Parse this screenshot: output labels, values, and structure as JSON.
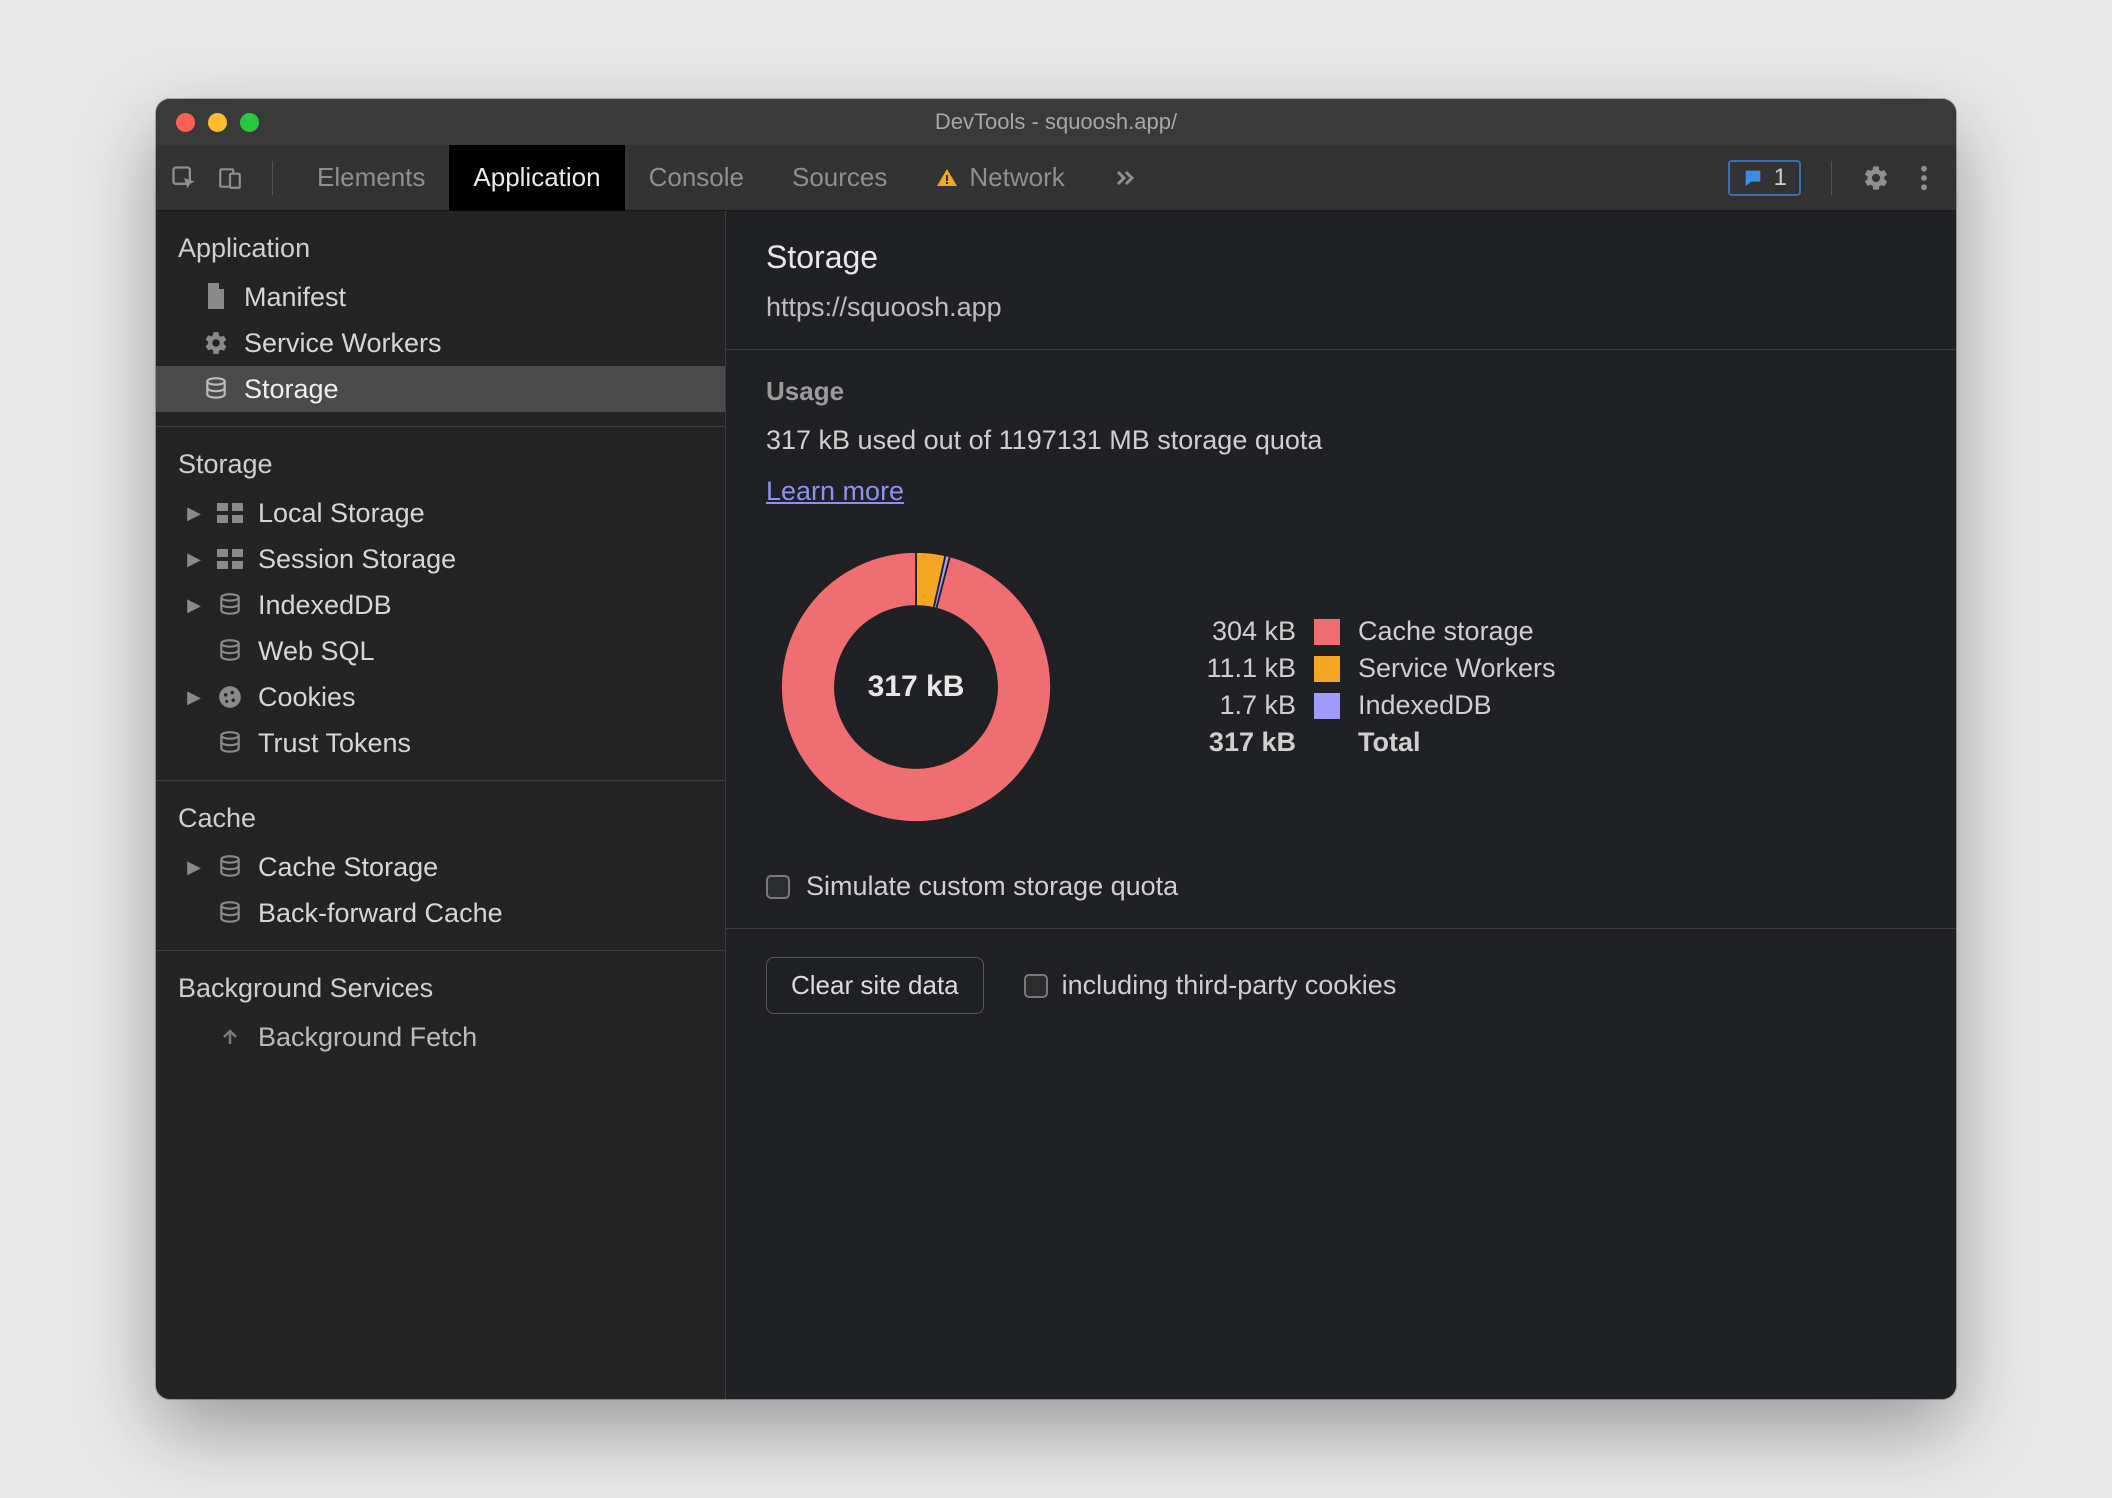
{
  "window": {
    "title": "DevTools - squoosh.app/"
  },
  "tabs": {
    "elements": "Elements",
    "application": "Application",
    "console": "Console",
    "sources": "Sources",
    "network": "Network"
  },
  "issues": {
    "count": "1"
  },
  "sidebar": {
    "sections": {
      "application": {
        "header": "Application",
        "items": [
          {
            "label": "Manifest"
          },
          {
            "label": "Service Workers"
          },
          {
            "label": "Storage"
          }
        ]
      },
      "storage": {
        "header": "Storage",
        "items": [
          {
            "label": "Local Storage"
          },
          {
            "label": "Session Storage"
          },
          {
            "label": "IndexedDB"
          },
          {
            "label": "Web SQL"
          },
          {
            "label": "Cookies"
          },
          {
            "label": "Trust Tokens"
          }
        ]
      },
      "cache": {
        "header": "Cache",
        "items": [
          {
            "label": "Cache Storage"
          },
          {
            "label": "Back-forward Cache"
          }
        ]
      },
      "bg": {
        "header": "Background Services",
        "items": [
          {
            "label": "Background Fetch"
          }
        ]
      }
    }
  },
  "panel": {
    "title": "Storage",
    "origin": "https://squoosh.app",
    "usage_header": "Usage",
    "usage_line": "317 kB used out of 1197131 MB storage quota",
    "learn_more": "Learn more",
    "donut_center": "317 kB",
    "legend": [
      {
        "value": "304 kB",
        "label": "Cache storage",
        "color": "#ef6e71"
      },
      {
        "value": "11.1 kB",
        "label": "Service Workers",
        "color": "#f5a623"
      },
      {
        "value": "1.7 kB",
        "label": "IndexedDB",
        "color": "#a29bfe"
      }
    ],
    "legend_total": {
      "value": "317 kB",
      "label": "Total"
    },
    "simulate_label": "Simulate custom storage quota",
    "clear_button": "Clear site data",
    "third_party_label": "including third-party cookies"
  },
  "chart_data": {
    "type": "pie",
    "title": "Storage usage breakdown",
    "unit": "kB",
    "total": 317,
    "series": [
      {
        "name": "Cache storage",
        "value": 304,
        "color": "#ef6e71"
      },
      {
        "name": "Service Workers",
        "value": 11.1,
        "color": "#f5a623"
      },
      {
        "name": "IndexedDB",
        "value": 1.7,
        "color": "#a29bfe"
      }
    ]
  }
}
